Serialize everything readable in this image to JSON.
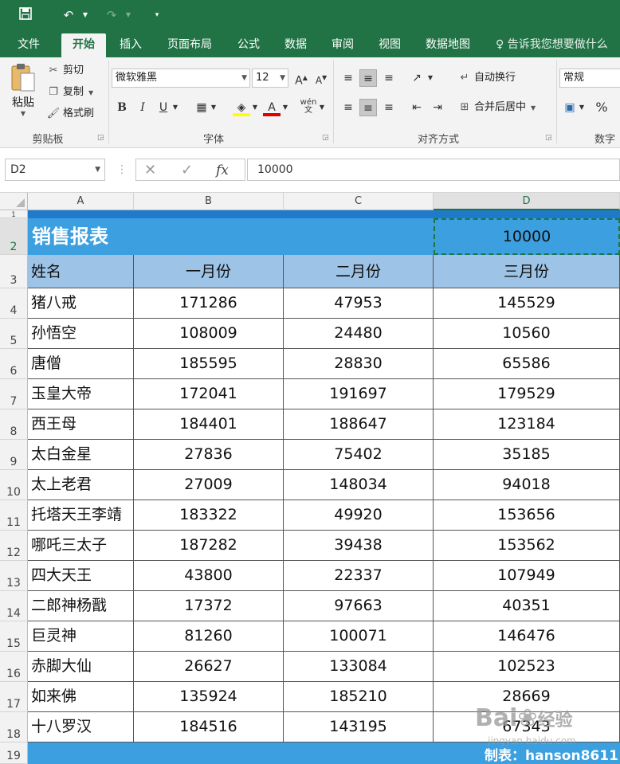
{
  "qat": {
    "save_icon": "save-icon",
    "undo_icon": "undo-icon",
    "redo_icon": "redo-icon",
    "customize_icon": "customize-icon"
  },
  "tabs": [
    {
      "label": "文件"
    },
    {
      "label": "开始"
    },
    {
      "label": "插入"
    },
    {
      "label": "页面布局"
    },
    {
      "label": "公式"
    },
    {
      "label": "数据"
    },
    {
      "label": "审阅"
    },
    {
      "label": "视图"
    },
    {
      "label": "数据地图"
    }
  ],
  "tell_me": "告诉我您想要做什么",
  "ribbon": {
    "clipboard": {
      "paste": "粘贴",
      "cut": "剪切",
      "copy": "复制",
      "format_painter": "格式刷",
      "label": "剪贴板"
    },
    "font": {
      "font_name": "微软雅黑",
      "font_size": "12",
      "bold": "B",
      "italic": "I",
      "underline": "U",
      "label": "字体"
    },
    "alignment": {
      "wrap_text": "自动换行",
      "merge_center": "合并后居中",
      "label": "对齐方式"
    },
    "number": {
      "format": "常规",
      "label": "数字",
      "percent": "%"
    }
  },
  "formula_bar": {
    "name_box": "D2",
    "fx": "fx",
    "value": "10000"
  },
  "columns": [
    "A",
    "B",
    "C",
    "D"
  ],
  "selected_column": "D",
  "selected_row": "2",
  "row_numbers": [
    "1",
    "2",
    "3",
    "4",
    "5",
    "6",
    "7",
    "8",
    "9",
    "10",
    "11",
    "12",
    "13",
    "14",
    "15",
    "16",
    "17",
    "18",
    "19"
  ],
  "sheet": {
    "title": "销售报表",
    "d2_value": "10000",
    "headers": [
      "姓名",
      "一月份",
      "二月份",
      "三月份"
    ],
    "rows": [
      {
        "name": "猪八戒",
        "jan": "171286",
        "feb": "47953",
        "mar": "145529"
      },
      {
        "name": "孙悟空",
        "jan": "108009",
        "feb": "24480",
        "mar": "10560"
      },
      {
        "name": "唐僧",
        "jan": "185595",
        "feb": "28830",
        "mar": "65586"
      },
      {
        "name": "玉皇大帝",
        "jan": "172041",
        "feb": "191697",
        "mar": "179529"
      },
      {
        "name": "西王母",
        "jan": "184401",
        "feb": "188647",
        "mar": "123184"
      },
      {
        "name": "太白金星",
        "jan": "27836",
        "feb": "75402",
        "mar": "35185"
      },
      {
        "name": "太上老君",
        "jan": "27009",
        "feb": "148034",
        "mar": "94018"
      },
      {
        "name": "托塔天王李靖",
        "jan": "183322",
        "feb": "49920",
        "mar": "153656"
      },
      {
        "name": "哪吒三太子",
        "jan": "187282",
        "feb": "39438",
        "mar": "153562"
      },
      {
        "name": "四大天王",
        "jan": "43800",
        "feb": "22337",
        "mar": "107949"
      },
      {
        "name": "二郎神杨戬",
        "jan": "17372",
        "feb": "97663",
        "mar": "40351"
      },
      {
        "name": "巨灵神",
        "jan": "81260",
        "feb": "100071",
        "mar": "146476"
      },
      {
        "name": "赤脚大仙",
        "jan": "26627",
        "feb": "133084",
        "mar": "102523"
      },
      {
        "name": "如来佛",
        "jan": "135924",
        "feb": "185210",
        "mar": "28669"
      },
      {
        "name": "十八罗汉",
        "jan": "184516",
        "feb": "143195",
        "mar": "67343"
      }
    ],
    "footer": "制表：hanson8611"
  },
  "watermark": {
    "brand": "Bai",
    "brand_cn": "经验",
    "url": "jingyan.baidu.com"
  }
}
